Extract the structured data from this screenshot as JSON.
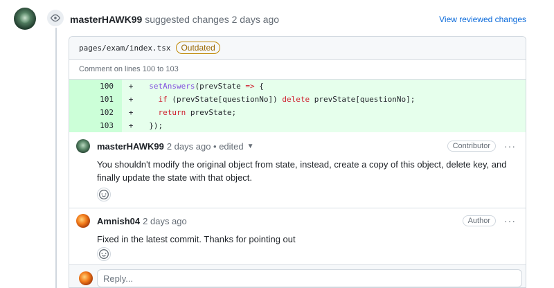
{
  "review": {
    "author": "masterHAWK99",
    "action_text": "suggested changes 2 days ago",
    "view_link": "View reviewed changes"
  },
  "file": {
    "path": "pages/exam/index.tsx",
    "badge": "Outdated",
    "comment_lines": "Comment on lines 100 to 103"
  },
  "diff_lines": [
    {
      "num": "100",
      "sign": "+"
    },
    {
      "num": "101",
      "sign": "+"
    },
    {
      "num": "102",
      "sign": "+"
    },
    {
      "num": "103",
      "sign": "+"
    }
  ],
  "code": {
    "l100_a": "  ",
    "l100_fn": "setAnswers",
    "l100_b": "(prevState ",
    "l100_kw": "=>",
    "l100_c": " {",
    "l101_a": "    ",
    "l101_kw1": "if",
    "l101_b": " (prevState[questionNo]) ",
    "l101_kw2": "delete",
    "l101_c": " prevState[questionNo];",
    "l102_a": "    ",
    "l102_kw": "return",
    "l102_b": " prevState;",
    "l103": "  });"
  },
  "comments": [
    {
      "author": "masterHAWK99",
      "meta": "2 days ago • edited",
      "role": "Contributor",
      "body": "You shouldn't modify the original object from state, instead, create a copy of this object, delete key, and finally update the state with that object."
    },
    {
      "author": "Amnish04",
      "meta": "2 days ago",
      "role": "Author",
      "body": "Fixed in the latest commit. Thanks for pointing out"
    }
  ],
  "reply": {
    "placeholder": "Reply..."
  },
  "icons": {
    "eye": "eye-icon",
    "caret": "triangle-down-icon",
    "kebab": "kebab-horizontal-icon",
    "smiley": "smiley-icon"
  },
  "colors": {
    "link": "#0969da",
    "outdated": "#9a6700",
    "diff_add_bg": "#e6ffec",
    "diff_add_num_bg": "#ccffd8"
  }
}
